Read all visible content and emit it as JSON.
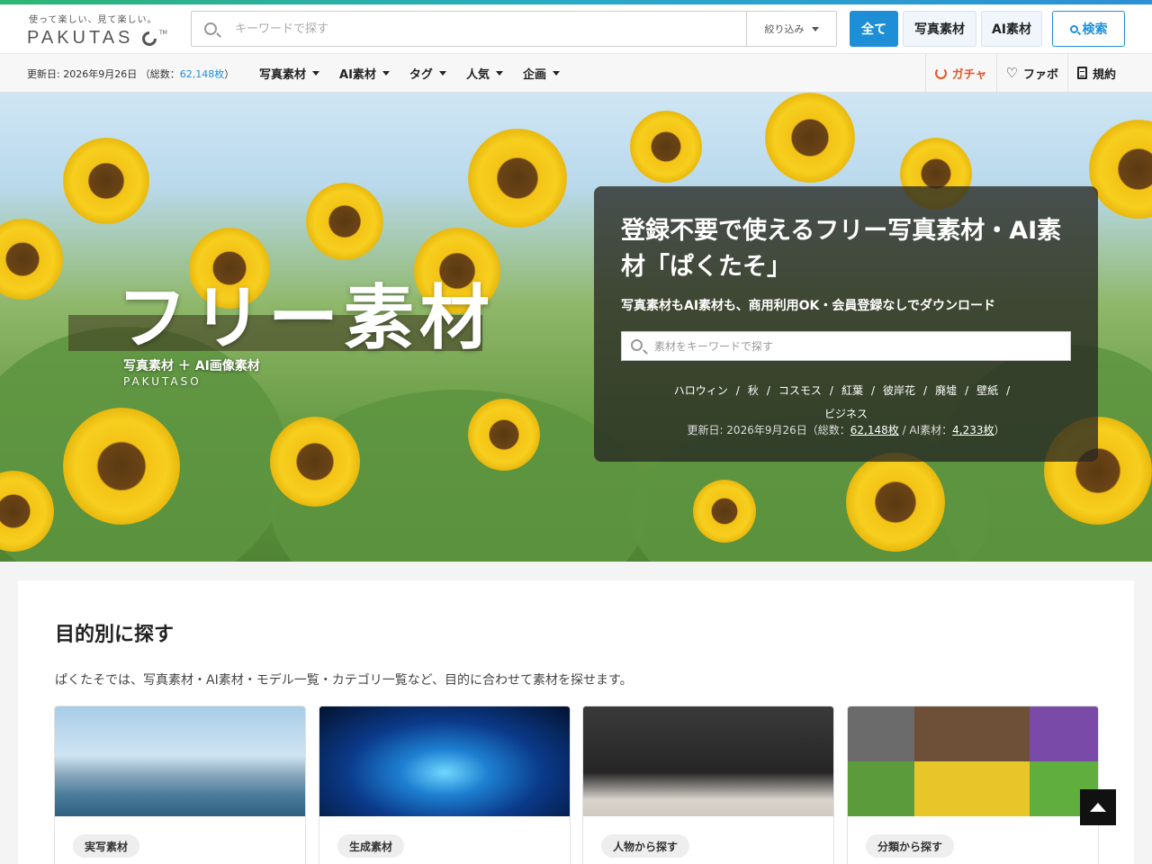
{
  "header": {
    "logo_tagline": "使って楽しい、見て楽しい。",
    "logo_text": "PAKUTAS",
    "logo_tm": "TM",
    "search_placeholder": "キーワードで探す",
    "filter_label": "絞り込み",
    "scope_all": "全て",
    "scope_photo": "写真素材",
    "scope_ai": "AI素材",
    "search_button": "検索"
  },
  "subnav": {
    "updated_prefix": "更新日: 2026年9月26日 （総数：",
    "updated_count": "62,148枚",
    "updated_suffix": "）",
    "menu": [
      {
        "label": "写真素材"
      },
      {
        "label": "AI素材"
      },
      {
        "label": "タグ"
      },
      {
        "label": "人気"
      },
      {
        "label": "企画"
      }
    ],
    "gacha": "ガチャ",
    "favorite": "ファボ",
    "terms": "規約"
  },
  "hero": {
    "title": "フリー素材",
    "subtitle": "写真素材 ＋ AI画像素材",
    "brand": "PAKUTASO",
    "panel_heading": "登録不要で使えるフリー写真素材・AI素材「ぱくたそ」",
    "panel_lead": "写真素材もAI素材も、商用利用OK・会員登録なしでダウンロード",
    "panel_search_placeholder": "素材をキーワードで探す",
    "tags": [
      "ハロウィン",
      "秋",
      "コスモス",
      "紅葉",
      "彼岸花",
      "廃墟",
      "壁紙",
      "ビジネス"
    ],
    "updated_prefix": "更新日: 2026年9月26日（総数：",
    "updated_total": "62,148枚",
    "updated_mid": " / AI素材：",
    "updated_ai": "4,233枚",
    "updated_suffix": "）"
  },
  "main": {
    "title": "目的別に探す",
    "description": "ぱくたそでは、写真素材・AI素材・モデル一覧・カテゴリ一覧など、目的に合わせて素材を探せます。",
    "cards": [
      {
        "label": "実写素材"
      },
      {
        "label": "生成素材"
      },
      {
        "label": "人物から探す"
      },
      {
        "label": "分類から探す"
      }
    ]
  },
  "colors": {
    "accent": "#1e8fd6",
    "gacha": "#e4572e",
    "brand_gradient_start": "#2bb673",
    "brand_gradient_end": "#2d8fd5"
  },
  "icons": {
    "search": "search-icon",
    "caret": "chevron-down-icon",
    "gacha": "refresh-icon",
    "favorite": "heart-icon",
    "terms": "document-icon",
    "to_top": "arrow-up-icon"
  }
}
